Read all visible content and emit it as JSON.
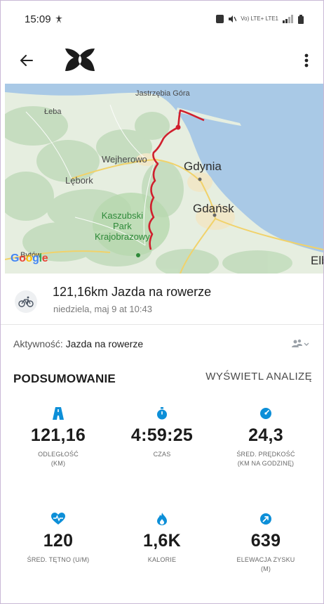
{
  "status_bar": {
    "time": "15:09",
    "right_text": "Vo) LTE+ LTE1"
  },
  "app_bar": {
    "back_icon": "arrow-left-icon",
    "logo": "under-armour-logo",
    "menu_icon": "more-vertical-icon"
  },
  "map": {
    "labels": {
      "jastrzebia": "Jastrzębia Góra",
      "leba": "Łeba",
      "wejherowo": "Wejherowo",
      "gdynia": "Gdynia",
      "lebork": "Lębork",
      "gdansk": "Gdańsk",
      "park": "Kaszubski\nPark\nKrajobrazowy",
      "bytow": "Bytów",
      "elb": "Elb"
    },
    "route_color": "#d0202e",
    "sea_color": "#a9c9e6",
    "land_color": "#e8efe4"
  },
  "activity": {
    "title": "121,16km Jazda na rowerze",
    "date": "niedziela, maj 9 at 10:43",
    "type_prefix": "Aktywność: ",
    "type_value": "Jazda na rowerze"
  },
  "summary": {
    "title": "PODSUMOWANIE",
    "analysis_link": "WYŚWIETL ANALIZĘ"
  },
  "stats": [
    {
      "icon": "road-icon",
      "value": "121,16",
      "label_1": "ODLEGŁOŚĆ",
      "label_2": "(KM)"
    },
    {
      "icon": "stopwatch-icon",
      "value": "4:59:25",
      "label_1": "CZAS",
      "label_2": ""
    },
    {
      "icon": "speed-gauge-icon",
      "value": "24,3",
      "label_1": "ŚRED. PRĘDKOŚĆ",
      "label_2": "(KM NA GODZINĘ)"
    },
    {
      "icon": "heart-rate-icon",
      "value": "120",
      "label_1": "ŚRED. TĘTNO (U/M)",
      "label_2": ""
    },
    {
      "icon": "flame-icon",
      "value": "1,6K",
      "label_1": "KALORIE",
      "label_2": ""
    },
    {
      "icon": "elevation-icon",
      "value": "639",
      "label_1": "ELEWACJA ZYSKU",
      "label_2": "(M)"
    }
  ],
  "colors": {
    "accent": "#0d8fd8",
    "route": "#d0202e"
  }
}
